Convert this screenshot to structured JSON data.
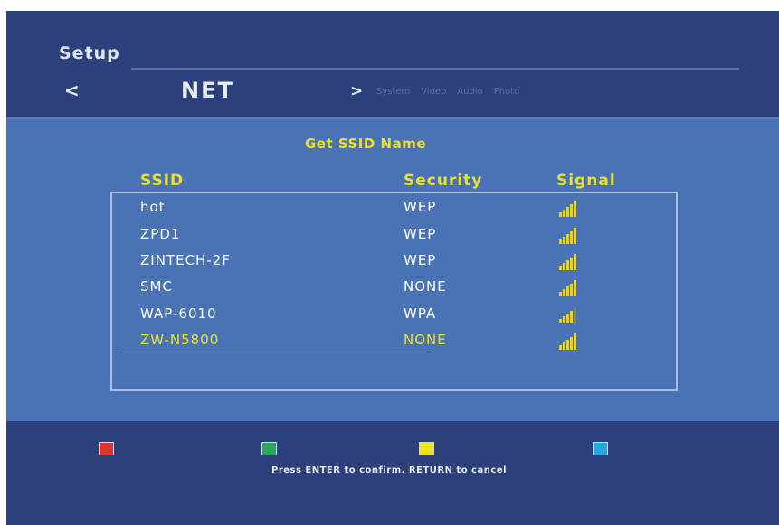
{
  "header": {
    "title": "Setup",
    "nav_prev": "<",
    "current_section": "NET",
    "nav_next": ">",
    "tabs": [
      "System",
      "Video",
      "Audio",
      "Photo"
    ]
  },
  "panel": {
    "title": "Get SSID Name",
    "columns": {
      "ssid": "SSID",
      "security": "Security",
      "signal": "Signal"
    },
    "networks": [
      {
        "ssid": "hot",
        "security": "WEP",
        "signal_bars": 5
      },
      {
        "ssid": "ZPD1",
        "security": "WEP",
        "signal_bars": 5
      },
      {
        "ssid": "ZINTECH-2F",
        "security": "WEP",
        "signal_bars": 5
      },
      {
        "ssid": "SMC",
        "security": "NONE",
        "signal_bars": 5
      },
      {
        "ssid": "WAP-6010",
        "security": "WPA",
        "signal_bars": 4
      },
      {
        "ssid": "ZW-N5800",
        "security": "NONE",
        "signal_bars": 5
      }
    ],
    "selected_index": 5
  },
  "footer": {
    "color_keys": [
      {
        "name": "red",
        "color": "#e0342e"
      },
      {
        "name": "green",
        "color": "#2fa65a"
      },
      {
        "name": "yellow",
        "color": "#efe21e"
      },
      {
        "name": "blue",
        "color": "#2aa6df"
      }
    ],
    "hint": "Press ENTER to confirm. RETURN to cancel"
  },
  "colors": {
    "accent": "#ece02a",
    "signal_bar": "#f0d400",
    "signal_bar_dim": "#7d8b5a"
  }
}
